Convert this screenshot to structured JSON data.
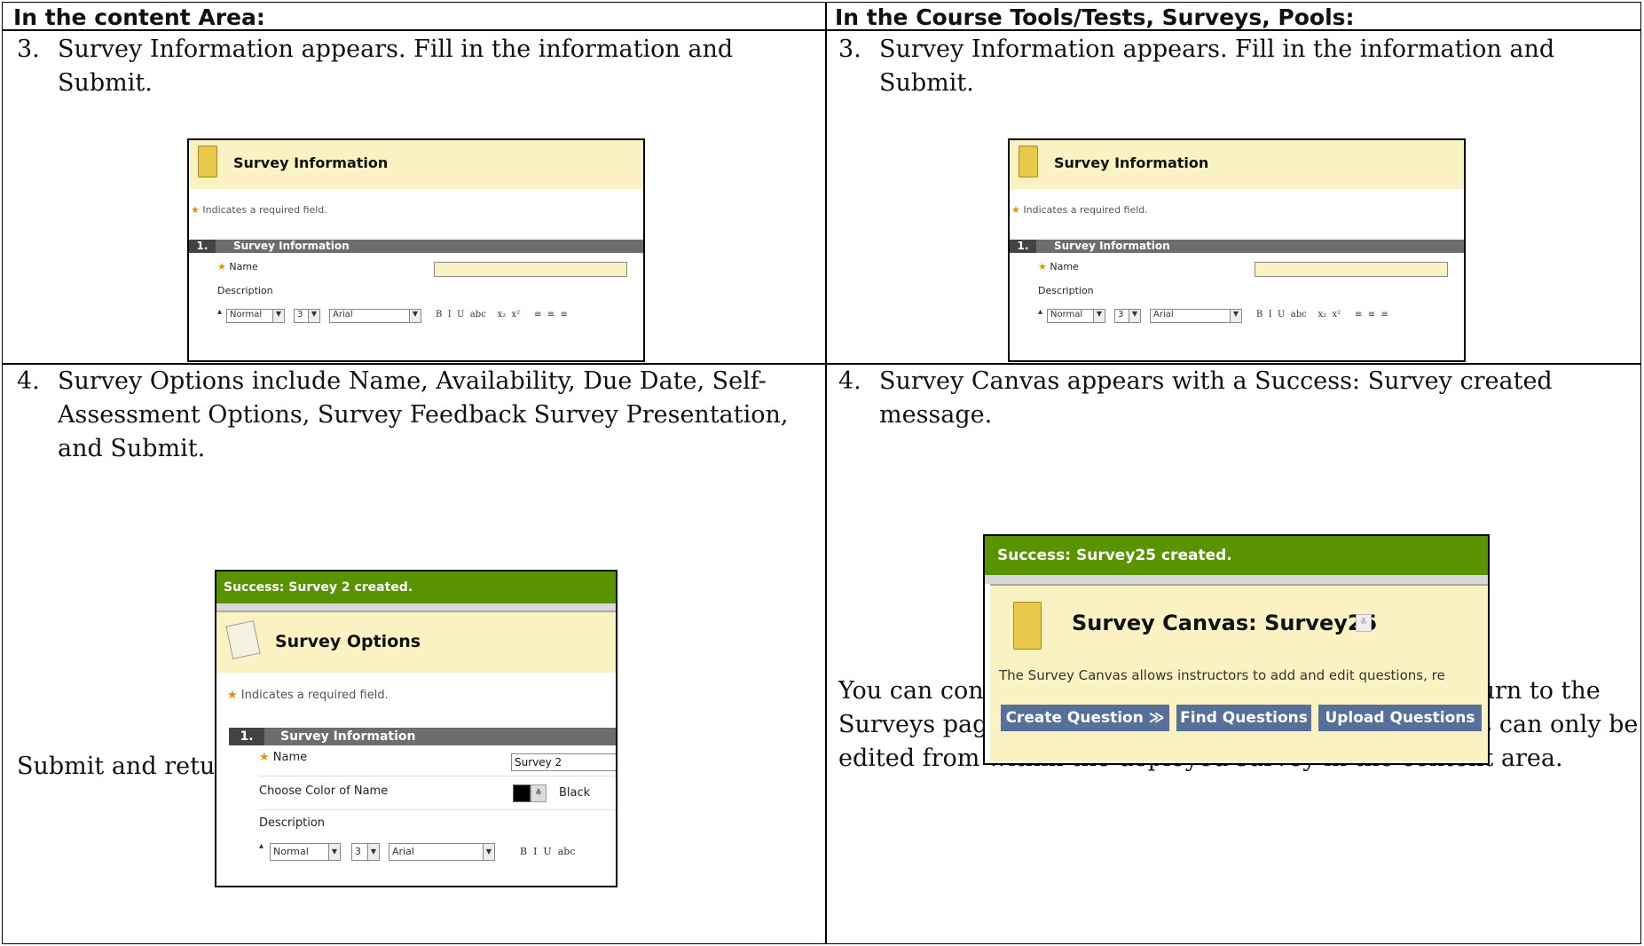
{
  "headers": {
    "left": "In the content Area:",
    "right": "In the Course Tools/Tests, Surveys, Pools:"
  },
  "row1": {
    "left": {
      "num": "3.",
      "line1": "Survey Information appears.  Fill in the information and",
      "line2": "Submit."
    },
    "right": {
      "num": "3.",
      "line1": "Survey Information appears.  Fill in the information and",
      "line2": "Submit."
    }
  },
  "row2": {
    "left": {
      "num": "4.",
      "line1": "Survey Options include Name, Availability, Due Date, Self-",
      "line2": "Assessment Options, Survey Feedback Survey Presentation,",
      "line3": "and Submit.",
      "after": "Submit and return to the content area."
    },
    "right": {
      "num": "4.",
      "line1": "Survey Canvas appears with a Success: Survey created",
      "line2": "message.",
      "after1": "You can continue to add questions, or click OK to return to the",
      "after2": "Surveys page with the list of Surveys. Survey Options can only be",
      "after3": "edited from within the deployed survey in the content area."
    }
  },
  "survey_info_shot": {
    "title": "Survey Information",
    "required": "Indicates a required field.",
    "section_num": "1.",
    "section_title": "Survey Information",
    "name_label": "Name",
    "desc_label": "Description",
    "style_value": "Normal",
    "size_value": "3",
    "font_value": "Arial",
    "format_buttons": "B  I  U  abc    x₂  x²     ≡  ≡  ≡"
  },
  "survey_options_shot": {
    "success": "Success: Survey 2 created.",
    "title": "Survey Options",
    "required": "Indicates a required field.",
    "section_num": "1.",
    "section_title": "Survey Information",
    "name_label": "Name",
    "name_value": "Survey 2",
    "color_label": "Choose Color of Name",
    "color_value": "Black",
    "desc_label": "Description",
    "style_value": "Normal",
    "size_value": "3",
    "font_value": "Arial",
    "format_buttons": "B  I  U  abc"
  },
  "survey_canvas_shot": {
    "success": "Success: Survey25 created.",
    "title": "Survey Canvas: Survey25",
    "desc": "The Survey Canvas allows instructors to add and edit questions, re",
    "btn_create": "Create Question  ≫",
    "btn_find": "Find Questions",
    "btn_upload": "Upload Questions"
  },
  "colors": {
    "band": "#fbf2c3",
    "success": "#5a9300",
    "section": "#6d6d6d",
    "button": "#56709a",
    "star": "#f08a00"
  }
}
